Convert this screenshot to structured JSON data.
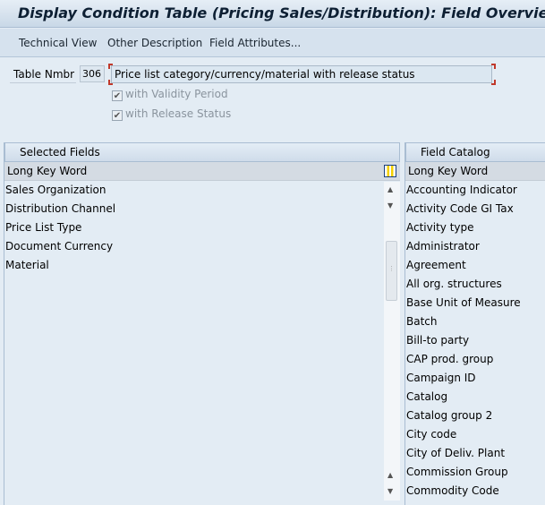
{
  "title": "Display Condition Table (Pricing Sales/Distribution): Field Overview",
  "toolbar": {
    "technical_view": "Technical View",
    "other_description": "Other Description",
    "field_attributes": "Field Attributes..."
  },
  "form": {
    "table_number_label": "Table Nmbr",
    "table_number": "306",
    "description": "Price list category/currency/material with release status",
    "with_validity_period": "with Validity Period",
    "with_release_status": "with Release Status",
    "validity_checked": true,
    "release_checked": true
  },
  "selected": {
    "title": "Selected Fields",
    "column": "Long Key Word",
    "items": [
      "Sales Organization",
      "Distribution Channel",
      "Price List Type",
      "Document Currency",
      "Material"
    ]
  },
  "catalog": {
    "title": "Field Catalog",
    "column": "Long Key Word",
    "items": [
      "Accounting Indicator",
      "Activity Code GI Tax",
      "Activity type",
      "Administrator",
      "Agreement",
      "All org. structures",
      "Base Unit of Measure",
      "Batch",
      "Bill-to party",
      "CAP prod. group",
      "Campaign ID",
      "Catalog",
      "Catalog group 2",
      "City code",
      "City of Deliv. Plant",
      "Commission Group",
      "Commodity Code"
    ]
  }
}
